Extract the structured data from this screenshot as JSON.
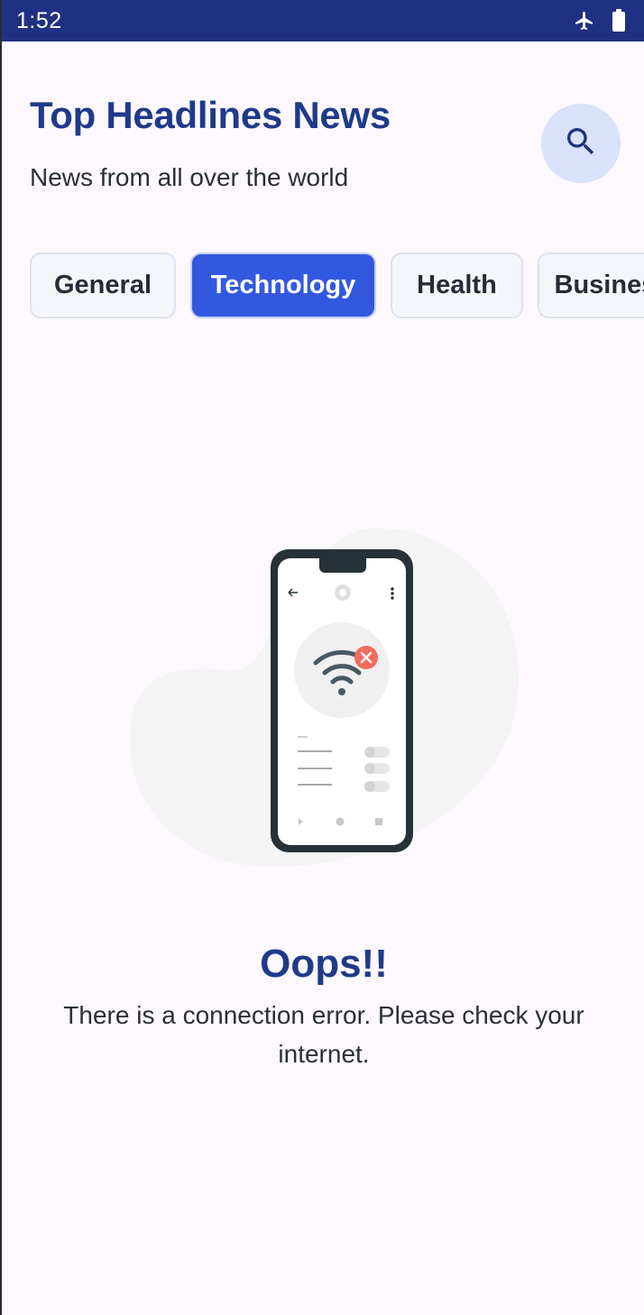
{
  "status_bar": {
    "time": "1:52",
    "icons": [
      "airplane-mode-icon",
      "battery-icon"
    ]
  },
  "header": {
    "title": "Top Headlines News",
    "subtitle": "News from all over the world",
    "search_icon": "search-icon"
  },
  "categories": [
    {
      "label": "General",
      "selected": false
    },
    {
      "label": "Technology",
      "selected": true
    },
    {
      "label": "Health",
      "selected": false
    },
    {
      "label": "Business",
      "selected": false
    }
  ],
  "error": {
    "illustration": "no-wifi-phone-illustration",
    "title": "Oops!!",
    "message": "There is a connection error. Please check your internet."
  },
  "colors": {
    "status_bar": "#1f3182",
    "accent": "#3358e0",
    "title": "#1f3a8a",
    "search_button_bg": "#d9e2fa",
    "error_badge": "#f26b5b"
  }
}
